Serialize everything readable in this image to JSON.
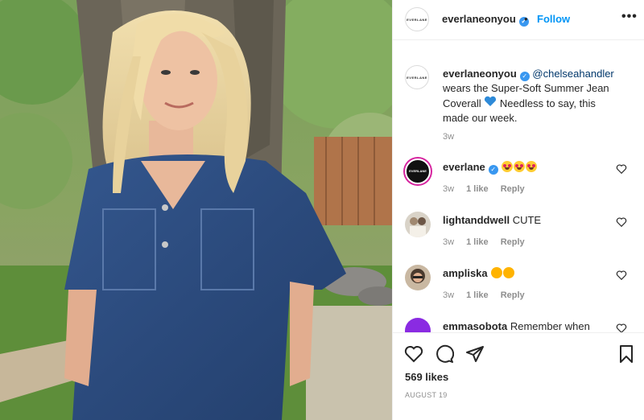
{
  "post": {
    "image_alt": "Woman with blonde hair wearing a denim coverall leaning against a tree",
    "author": "everlaneonyou",
    "avatar_text": "EVERLANE",
    "follow_label": "Follow",
    "separator": "•",
    "more_icon": "more-horizontal-icon",
    "caption": {
      "author": "everlaneonyou",
      "mention": "@chelseahandler",
      "text_before_heart": " wears the Super-Soft Summer Jean Coverall ",
      "text_after_heart": " Needless to say, this made our week.",
      "time": "3w"
    },
    "comments": [
      {
        "user": "everlane",
        "text": "",
        "emoji": [
          "heart-eyes",
          "heart-eyes",
          "heart-eyes"
        ],
        "time": "3w",
        "likes": "1 like",
        "reply": "Reply",
        "verified": true
      },
      {
        "user": "lightanddwell",
        "text": "CUTE",
        "time": "3w",
        "likes": "1 like",
        "reply": "Reply",
        "verified": false
      },
      {
        "user": "ampliska",
        "text": "",
        "emoji": [
          "clap",
          "clap"
        ],
        "time": "3w",
        "likes": "1 like",
        "reply": "Reply",
        "verified": false
      },
      {
        "user": "emmasobota",
        "text": "Remember when",
        "time": "",
        "likes": "",
        "reply": "",
        "verified": false
      }
    ],
    "likes_count": "569 likes",
    "date": "AUGUST 19"
  },
  "colors": {
    "link_blue": "#0095f6",
    "verified_blue": "#3897f0",
    "muted": "#8e8e8e",
    "text": "#262626"
  }
}
